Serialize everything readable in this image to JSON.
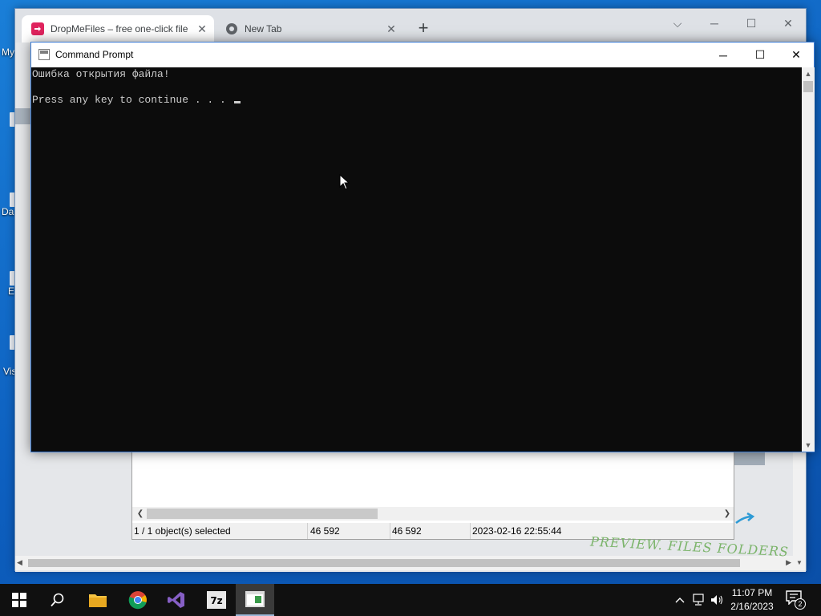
{
  "desktop": {
    "icons": [
      {
        "label": "My"
      },
      {
        "label": "Da"
      },
      {
        "label": "E"
      },
      {
        "label": "Vis"
      }
    ]
  },
  "browser": {
    "tabs": [
      {
        "title": "DropMeFiles – free one-click file",
        "active": true,
        "icon": "dropmefiles-icon"
      },
      {
        "title": "New Tab",
        "active": false,
        "icon": "chrome-icon"
      }
    ],
    "new_tab_symbol": "+",
    "controls": {
      "dropdown": "⌵",
      "minimize": "─",
      "maximize": "☐",
      "close": "✕"
    }
  },
  "file_panel": {
    "status": {
      "selection": "1 / 1 object(s) selected",
      "size": "46 592",
      "packed": "46 592",
      "modified": "2023-02-16 22:55:44"
    },
    "promo_text": "PREVIEW. FILES FOLDERS"
  },
  "cmd": {
    "title": "Command Prompt",
    "lines": [
      "Ошибка открытия файла!",
      "",
      "Press any key to continue . . . "
    ],
    "controls": {
      "minimize": "─",
      "maximize": "☐",
      "close": "✕"
    }
  },
  "taskbar": {
    "apps": [
      "start",
      "search",
      "file-explorer",
      "chrome",
      "visual-studio",
      "7zip",
      "command-prompt"
    ],
    "active_app": "command-prompt",
    "clock": {
      "time": "11:07 PM",
      "date": "2/16/2023"
    },
    "notifications_count": "2"
  },
  "colors": {
    "desktop": "#1a7fd8",
    "console_bg": "#0c0c0c",
    "console_text": "#cccccc",
    "taskbar": "#101010"
  }
}
